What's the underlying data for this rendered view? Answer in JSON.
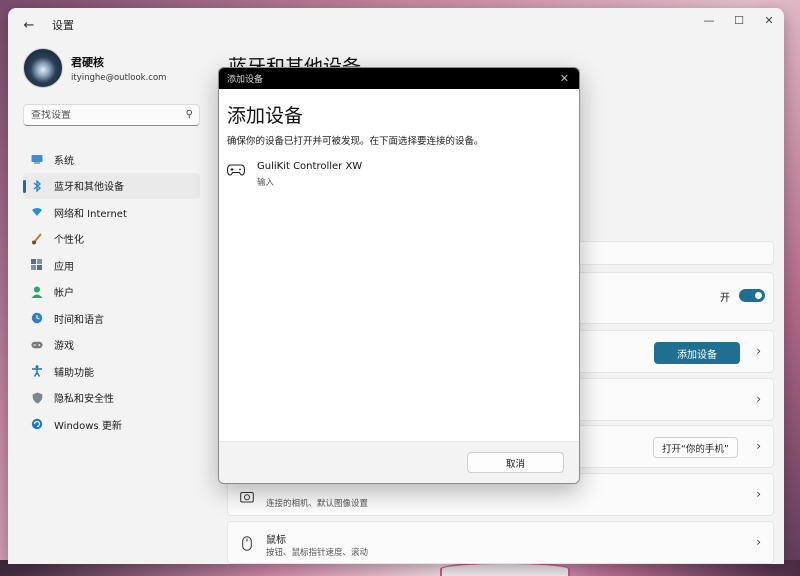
{
  "window": {
    "title": "设置",
    "back_icon": "back-arrow-icon",
    "controls": [
      "minimize-icon",
      "maximize-icon",
      "close-icon"
    ]
  },
  "profile": {
    "name": "君硬核",
    "email": "ityinghe@outlook.com"
  },
  "search": {
    "placeholder": "查找设置"
  },
  "nav": {
    "items": [
      {
        "label": "系统",
        "icon": "display-icon",
        "color": "#2a7fc7"
      },
      {
        "label": "蓝牙和其他设备",
        "icon": "bluetooth-icon",
        "color": "#2a7fc7",
        "active": true
      },
      {
        "label": "网络和 Internet",
        "icon": "wifi-icon",
        "color": "#2a8fd9"
      },
      {
        "label": "个性化",
        "icon": "brush-icon",
        "color": "#c0792a"
      },
      {
        "label": "应用",
        "icon": "apps-icon",
        "color": "#5a6f85"
      },
      {
        "label": "帐户",
        "icon": "account-icon",
        "color": "#2aa36b"
      },
      {
        "label": "时间和语言",
        "icon": "clock-globe-icon",
        "color": "#2a7fc7"
      },
      {
        "label": "游戏",
        "icon": "gamepad-icon",
        "color": "#6b6b6b"
      },
      {
        "label": "辅助功能",
        "icon": "accessibility-icon",
        "color": "#1f6fb0"
      },
      {
        "label": "隐私和安全性",
        "icon": "shield-icon",
        "color": "#6b7580"
      },
      {
        "label": "Windows 更新",
        "icon": "update-icon",
        "color": "#1f78c8"
      }
    ]
  },
  "content": {
    "page_title": "蓝牙和其他设备",
    "bluetooth_toggle_label": "开",
    "add_device_button": "添加设备",
    "phone_button": "打开“你的手机”",
    "camera_subtitle": "连接的相机、默认图像设置",
    "mouse_title": "鼠标",
    "mouse_subtitle": "按钮、鼠标指针速度、滚动"
  },
  "dialog": {
    "titlebar": "添加设备",
    "heading": "添加设备",
    "description": "确保你的设备已打开并可被发现。在下面选择要连接的设备。",
    "devices": [
      {
        "name": "GuliKit Controller XW",
        "type": "输入",
        "icon": "gamepad-icon"
      }
    ],
    "cancel_button": "取消"
  },
  "colors": {
    "accent": "#1f6f92",
    "window_bg": "#f3f3f3",
    "card_bg": "#fbfbfb",
    "dialog_titlebar": "#000000"
  }
}
